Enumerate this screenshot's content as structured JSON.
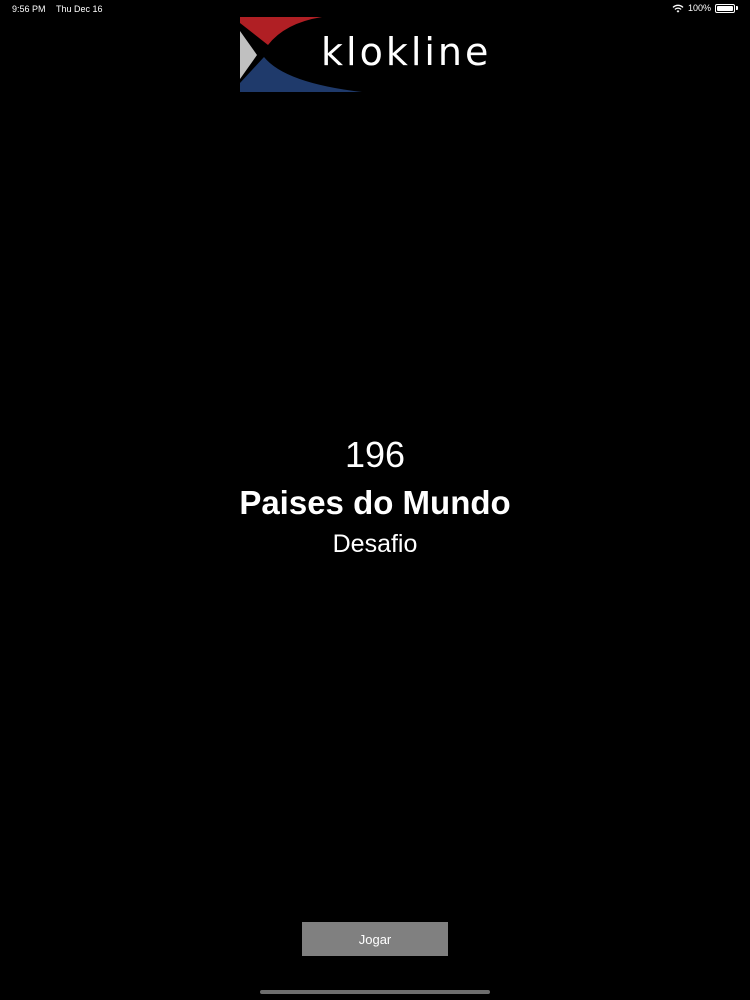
{
  "status_bar": {
    "time": "9:56 PM",
    "date": "Thu Dec 16",
    "battery_percent": "100%",
    "battery_level": 1.0,
    "icons": [
      "wifi-icon",
      "battery-icon"
    ]
  },
  "logo": {
    "text": "klokline",
    "colors": {
      "red": "#b01f24",
      "blue": "#1f3a6b",
      "gray": "#c0c0c0"
    }
  },
  "main": {
    "count": "196",
    "title": "Paises do Mundo",
    "subtitle": "Desafio"
  },
  "actions": {
    "play_label": "Jogar"
  },
  "colors": {
    "background": "#000000",
    "text": "#ffffff",
    "button": "#808080"
  }
}
